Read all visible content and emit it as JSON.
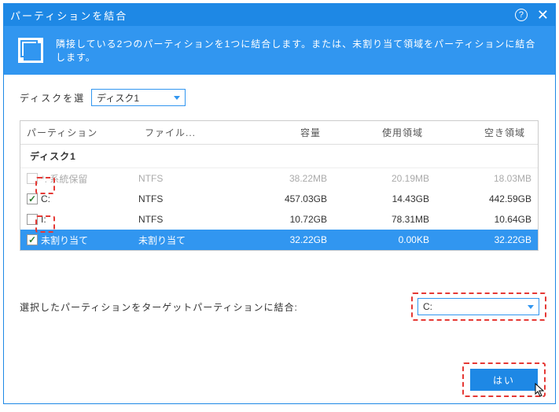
{
  "title": "パーティションを結合",
  "banner": "隣接している2つのパーティションを1つに結合します。または、未割り当て領域をパーティションに結合します。",
  "disk_select": {
    "label": "ディスクを選",
    "value": "ディスク1"
  },
  "columns": {
    "partition": "パーティション",
    "fs": "ファイル...",
    "capacity": "容量",
    "used": "使用領域",
    "free": "空き領域"
  },
  "disk_header": "ディスク1",
  "rows": [
    {
      "checked": false,
      "disabled": true,
      "label": "*: 系統保留",
      "fs": "NTFS",
      "capacity": "38.22MB",
      "used": "20.19MB",
      "free": "18.03MB",
      "selected": false
    },
    {
      "checked": true,
      "disabled": false,
      "label": "C:",
      "fs": "NTFS",
      "capacity": "457.03GB",
      "used": "14.43GB",
      "free": "442.59GB",
      "selected": false
    },
    {
      "checked": false,
      "disabled": false,
      "label": "I:",
      "fs": "NTFS",
      "capacity": "10.72GB",
      "used": "78.31MB",
      "free": "10.64GB",
      "selected": false
    },
    {
      "checked": true,
      "disabled": false,
      "label": "未割り当て",
      "fs": "未割り当て",
      "capacity": "32.22GB",
      "used": "0.00KB",
      "free": "32.22GB",
      "selected": true
    }
  ],
  "target": {
    "label": "選択したパーティションをターゲットパーティションに結合:",
    "value": "C:"
  },
  "buttons": {
    "ok": "はい"
  }
}
